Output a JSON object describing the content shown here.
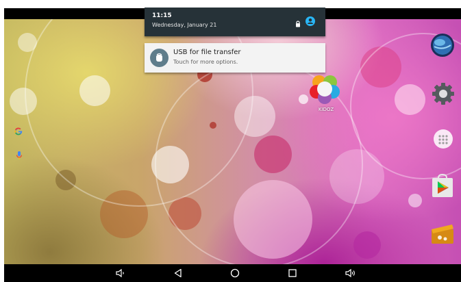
{
  "notification_shade": {
    "time": "11:15",
    "date": "Wednesday, January 21",
    "icons": [
      "lock-icon",
      "account-circle-icon"
    ]
  },
  "notification": {
    "icon": "usb-icon",
    "title": "USB for file transfer",
    "subtitle": "Touch for more options."
  },
  "home_screen": {
    "apps": [
      {
        "label": "KIDOZ",
        "icon": "kidoz-icon"
      }
    ],
    "dock_icons": [
      "browser-globe-icon",
      "settings-gear-icon",
      "app-drawer-icon",
      "play-store-icon",
      "clapperboard-icon"
    ],
    "left_widgets": [
      "google-g-icon",
      "microphone-icon"
    ]
  },
  "navigation_bar": {
    "buttons": [
      "volume-down-icon",
      "back-icon",
      "home-icon",
      "recents-icon",
      "volume-up-icon"
    ]
  },
  "colors": {
    "shade_bg": "#263238",
    "card_bg": "#f3f3f3",
    "account_accent": "#29b6f6",
    "usb_icon_bg": "#5f7d8b"
  }
}
